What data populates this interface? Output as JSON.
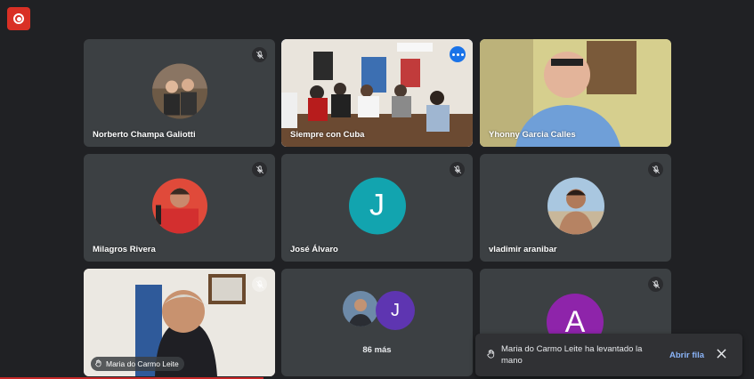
{
  "app": {
    "record_icon": "record-icon",
    "accent": "#d93025",
    "highlight": "#8ab4f8"
  },
  "tiles": [
    {
      "name": "Norberto Champa Galiotti",
      "muted": true
    },
    {
      "name": "Siempre con Cuba",
      "speaking": true
    },
    {
      "name": "Yhonny Garcia Calles",
      "muted": false
    },
    {
      "name": "Milagros Rivera",
      "muted": true
    },
    {
      "name": "José Álvaro",
      "initial": "J",
      "avatar_color": "#12a4af",
      "muted": true
    },
    {
      "name": "vladimir aranibar",
      "muted": true
    },
    {
      "name": "Maria do Carmo Leite",
      "muted": true
    },
    {
      "more_label": "86 más",
      "initial": "J",
      "avatar_color": "#5e35b1"
    },
    {
      "initial": "A",
      "avatar_color": "#8e24aa",
      "muted": true
    }
  ],
  "toast": {
    "message": "Maria do Carmo Leite ha levantado la mano",
    "action": "Abrir fila",
    "icon": "raised-hand-icon",
    "close_icon": "close-icon"
  },
  "progress": {
    "value": 0.35,
    "color": "#c62828"
  }
}
